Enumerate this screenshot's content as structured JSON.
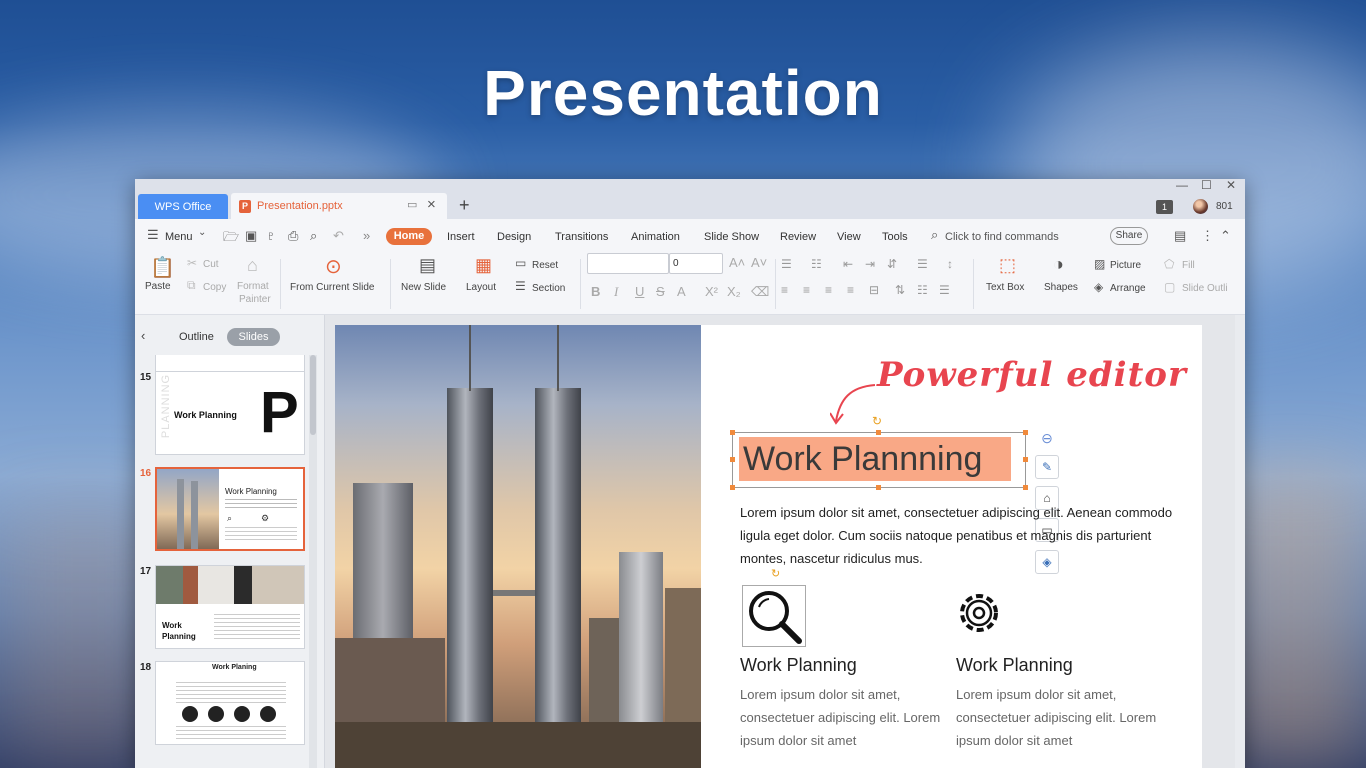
{
  "headline": "Presentation",
  "titlebar": {
    "tab_home": "WPS Office",
    "tab_doc": "Presentation.pptx",
    "add_tab": "+",
    "badge": "1",
    "user_count": "801",
    "min": "—",
    "max": "☐",
    "close": "✕"
  },
  "menubar": {
    "menu": "Menu",
    "tabs": [
      "Home",
      "Insert",
      "Design",
      "Transitions",
      "Animation",
      "Slide Show",
      "Review",
      "View",
      "Tools"
    ],
    "search_placeholder": "Click to find commands",
    "share": "Share"
  },
  "ribbon": {
    "paste": "Paste",
    "cut": "Cut",
    "copy": "Copy",
    "format_painter_1": "Format",
    "format_painter_2": "Painter",
    "from_current_slide": "From Current Slide",
    "new_slide": "New Slide",
    "layout": "Layout",
    "reset": "Reset",
    "section": "Section",
    "font_name": "",
    "font_size": "0",
    "text_box": "Text Box",
    "shapes": "Shapes",
    "picture": "Picture",
    "arrange": "Arrange",
    "fill": "Fill",
    "slide_outline": "Slide Outli"
  },
  "panel": {
    "outline": "Outline",
    "slides": "Slides",
    "thumbs": [
      {
        "num": "15",
        "title": "Work Planning",
        "letter": "P",
        "side": "PLANNING"
      },
      {
        "num": "16",
        "title": "Work Planning"
      },
      {
        "num": "17",
        "title": "Work Planning"
      },
      {
        "num": "18",
        "title": "Work Planing"
      }
    ]
  },
  "slide": {
    "annotation": "Powerful editor",
    "title": "Work Plannning",
    "body": "Lorem ipsum dolor sit amet, consectetuer adipiscing elit. Aenean commodo ligula eget dolor. Cum sociis natoque penatibus et magnis dis parturient montes, nascetur ridiculus mus.",
    "col1_title": "Work Planning",
    "col1_text": "Lorem ipsum dolor sit amet, consectetuer adipiscing elit. Lorem ipsum dolor sit amet",
    "col2_title": "Work Planning",
    "col2_text": "Lorem ipsum dolor sit amet, consectetuer adipiscing elit. Lorem ipsum dolor sit amet"
  },
  "colors": {
    "accent": "#e5633b",
    "tab_blue": "#4a8ef3",
    "title_highlight": "#f9a886",
    "annotation": "#e8454f"
  }
}
